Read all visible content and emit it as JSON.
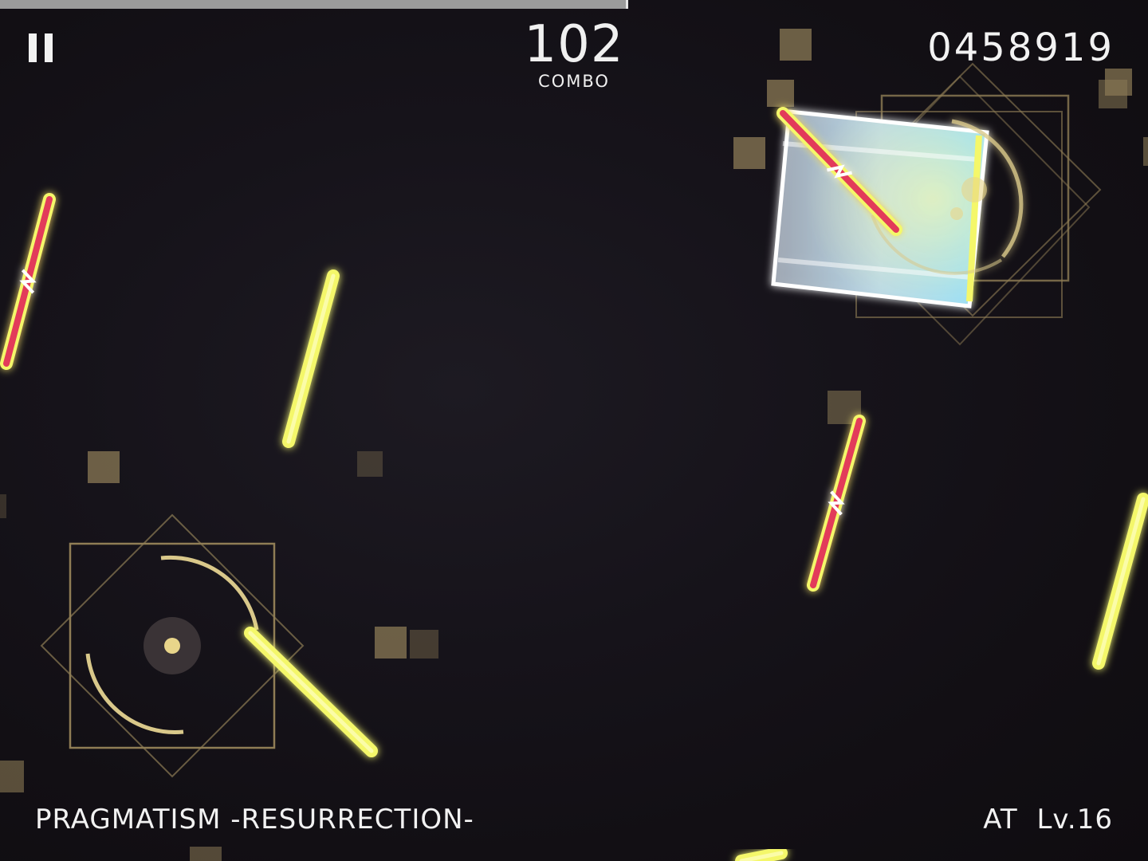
{
  "hud": {
    "combo_count": "102",
    "combo_label": "COMBO",
    "score": "0458919",
    "song_title": "PRAGMATISM -RESURRECTION-",
    "difficulty": "AT  Lv.16",
    "progress": 0.545
  },
  "colors": {
    "note_glow": "#f4f76a",
    "note_core": "#e23a5a",
    "particle": "#8b7a55",
    "judgment_frame": "#8f7d55",
    "hold_tile": "#9ad7f2",
    "progress_fill": "#9b9b9b"
  },
  "icons": {
    "pause": "pause-icon"
  }
}
